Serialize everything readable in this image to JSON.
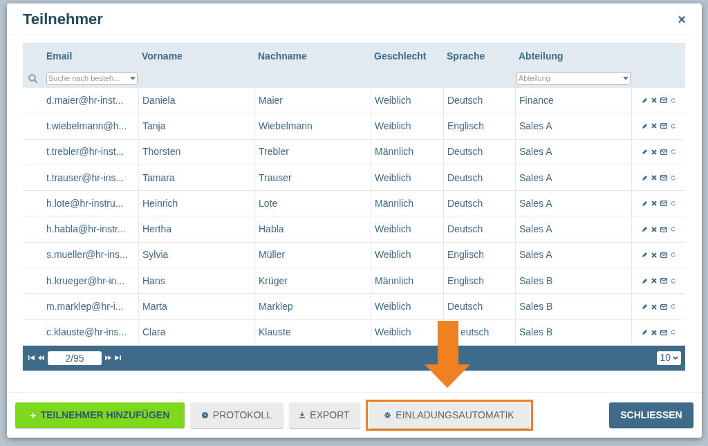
{
  "dialog": {
    "title": "Teilnehmer",
    "close": "×"
  },
  "table": {
    "columns": [
      "Email",
      "Vorname",
      "Nachname",
      "Geschlecht",
      "Sprache",
      "Abteilung"
    ],
    "filters": {
      "email_placeholder": "Suche nach besteh...",
      "abteilung_placeholder": "Abteilung"
    },
    "rows": [
      {
        "email": "d.maier@hr-inst...",
        "vorname": "Daniela",
        "nachname": "Maier",
        "geschlecht": "Weiblich",
        "sprache": "Deutsch",
        "abteilung": "Finance"
      },
      {
        "email": "t.wiebelmann@h...",
        "vorname": "Tanja",
        "nachname": "Wiebelmann",
        "geschlecht": "Weiblich",
        "sprache": "Englisch",
        "abteilung": "Sales A"
      },
      {
        "email": "t.trebler@hr-inst...",
        "vorname": "Thorsten",
        "nachname": "Trebler",
        "geschlecht": "Männlich",
        "sprache": "Deutsch",
        "abteilung": "Sales A"
      },
      {
        "email": "t.trauser@hr-ins...",
        "vorname": "Tamara",
        "nachname": "Trauser",
        "geschlecht": "Weiblich",
        "sprache": "Deutsch",
        "abteilung": "Sales A"
      },
      {
        "email": "h.lote@hr-instru...",
        "vorname": "Heinrich",
        "nachname": "Lote",
        "geschlecht": "Männlich",
        "sprache": "Deutsch",
        "abteilung": "Sales A"
      },
      {
        "email": "h.habla@hr-instr...",
        "vorname": "Hertha",
        "nachname": "Habla",
        "geschlecht": "Weiblich",
        "sprache": "Deutsch",
        "abteilung": "Sales A"
      },
      {
        "email": "s.mueller@hr-ins...",
        "vorname": "Sylvia",
        "nachname": "Müller",
        "geschlecht": "Weiblich",
        "sprache": "Englisch",
        "abteilung": "Sales A"
      },
      {
        "email": "h.krueger@hr-in...",
        "vorname": "Hans",
        "nachname": "Krüger",
        "geschlecht": "Männlich",
        "sprache": "Englisch",
        "abteilung": "Sales B"
      },
      {
        "email": "m.marklep@hr-i...",
        "vorname": "Marta",
        "nachname": "Marklep",
        "geschlecht": "Weiblich",
        "sprache": "Deutsch",
        "abteilung": "Sales B"
      },
      {
        "email": "c.klauste@hr-ins...",
        "vorname": "Clara",
        "nachname": "Klauste",
        "geschlecht": "Weiblich",
        "sprache": "eutsch",
        "abteilung": "Sales B"
      }
    ],
    "pager": {
      "page": "2/95",
      "page_size": "10"
    }
  },
  "footer_buttons": [
    {
      "label": "TEILNEHMER HINZUFÜGEN",
      "kind": "add",
      "highlighted": false
    },
    {
      "label": "PROTOKOLL",
      "kind": "log",
      "highlighted": false
    },
    {
      "label": "EXPORT",
      "kind": "export",
      "highlighted": false
    },
    {
      "label": "EINLADUNGSAUTOMATIK",
      "kind": "automation",
      "highlighted": true
    },
    {
      "label": "SCHLIESSEN",
      "kind": "close",
      "highlighted": false
    }
  ]
}
